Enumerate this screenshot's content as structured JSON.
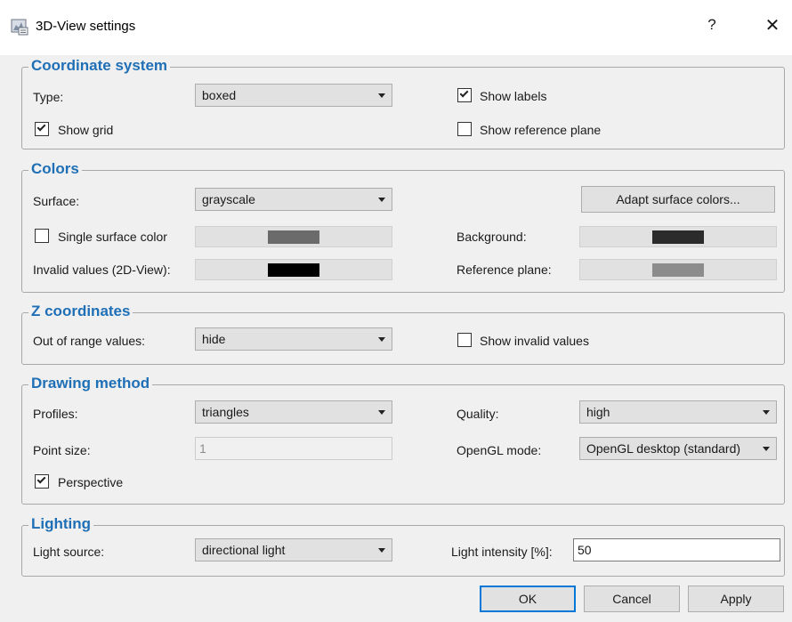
{
  "window": {
    "title": "3D-View settings",
    "help": "?",
    "close": "✕"
  },
  "coordinate_system": {
    "title": "Coordinate system",
    "type_label": "Type:",
    "type_value": "boxed",
    "show_labels": {
      "label": "Show labels",
      "checked": true
    },
    "show_grid": {
      "label": "Show grid",
      "checked": true
    },
    "show_reference_plane": {
      "label": "Show reference plane",
      "checked": false
    }
  },
  "colors": {
    "title": "Colors",
    "surface_label": "Surface:",
    "surface_value": "grayscale",
    "adapt_button": "Adapt surface colors...",
    "single_surface_color": {
      "label": "Single surface color",
      "checked": false,
      "color": "#6b6b6b"
    },
    "background": {
      "label": "Background:",
      "color": "#2b2b2b"
    },
    "invalid_values": {
      "label": "Invalid values (2D-View):",
      "color": "#000000"
    },
    "reference_plane": {
      "label": "Reference plane:",
      "color": "#8c8c8c"
    }
  },
  "z_coordinates": {
    "title": "Z coordinates",
    "out_of_range_label": "Out of range values:",
    "out_of_range_value": "hide",
    "show_invalid_values": {
      "label": "Show invalid values",
      "checked": false
    }
  },
  "drawing_method": {
    "title": "Drawing method",
    "profiles_label": "Profiles:",
    "profiles_value": "triangles",
    "quality_label": "Quality:",
    "quality_value": "high",
    "point_size_label": "Point size:",
    "point_size_value": "1",
    "opengl_label": "OpenGL mode:",
    "opengl_value": "OpenGL desktop (standard)",
    "perspective": {
      "label": "Perspective",
      "checked": true
    }
  },
  "lighting": {
    "title": "Lighting",
    "light_source_label": "Light source:",
    "light_source_value": "directional light",
    "intensity_label": "Light intensity [%]:",
    "intensity_value": "50"
  },
  "buttons": {
    "ok": "OK",
    "cancel": "Cancel",
    "apply": "Apply"
  }
}
